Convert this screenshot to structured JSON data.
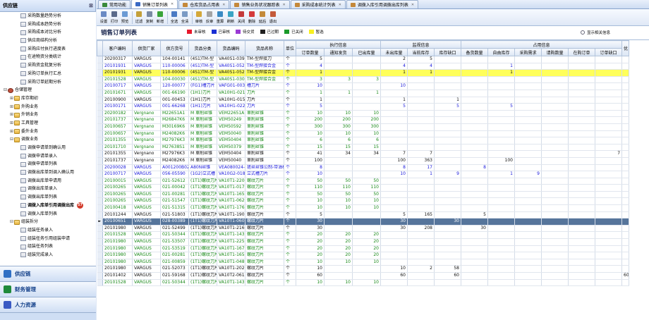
{
  "sidebar": {
    "title": "供应链",
    "tree": [
      {
        "label": "采购数量趋势分析",
        "level": 2,
        "type": "doc"
      },
      {
        "label": "采购成本趋势分析",
        "level": 2,
        "type": "doc"
      },
      {
        "label": "采购成本对比分析",
        "level": 2,
        "type": "doc"
      },
      {
        "label": "供应商结构分析",
        "level": 2,
        "type": "doc"
      },
      {
        "label": "采购应付执行进度表",
        "level": 2,
        "type": "doc"
      },
      {
        "label": "在途物资分类统计",
        "level": 2,
        "type": "doc"
      },
      {
        "label": "采购资金批复分析",
        "level": 2,
        "type": "doc"
      },
      {
        "label": "采购订单执行汇总",
        "level": 2,
        "type": "doc"
      },
      {
        "label": "采购订单延期分析",
        "level": 2,
        "type": "doc"
      },
      {
        "label": "仓储管理",
        "level": 0,
        "type": "gear",
        "exp": "⊟"
      },
      {
        "label": "库存期初",
        "level": 1,
        "type": "fold",
        "exp": "⊞"
      },
      {
        "label": "外购业务",
        "level": 1,
        "type": "fold",
        "exp": "⊞"
      },
      {
        "label": "外销业务",
        "level": 1,
        "type": "fold",
        "exp": "⊞"
      },
      {
        "label": "工具管理",
        "level": 1,
        "type": "fold",
        "exp": "⊞"
      },
      {
        "label": "委外业务",
        "level": 1,
        "type": "fold",
        "exp": "⊞"
      },
      {
        "label": "调拨业务",
        "level": 1,
        "type": "fold",
        "exp": "⊟"
      },
      {
        "label": "调拨申请单到确认用",
        "level": 2,
        "type": "doc"
      },
      {
        "label": "调拨申请单录入",
        "level": 2,
        "type": "doc"
      },
      {
        "label": "调拨申请单列表",
        "level": 2,
        "type": "doc"
      },
      {
        "label": "调拨出库单到调入确认用",
        "level": 2,
        "type": "doc"
      },
      {
        "label": "调拨出库单申请用",
        "level": 2,
        "type": "doc"
      },
      {
        "label": "调拨出库单录入",
        "level": 2,
        "type": "doc"
      },
      {
        "label": "调拨出库单列表",
        "level": 2,
        "type": "doc"
      },
      {
        "label": "调拨入库单引用调拨出库",
        "level": 2,
        "type": "doc",
        "selected": true,
        "badge": "57"
      },
      {
        "label": "调拨入库单列表",
        "level": 2,
        "type": "doc"
      },
      {
        "label": "组装拆分",
        "level": 1,
        "type": "fold",
        "exp": "⊟"
      },
      {
        "label": "组装任务录入",
        "level": 2,
        "type": "doc"
      },
      {
        "label": "组装任务引用组装申请",
        "level": 2,
        "type": "doc"
      },
      {
        "label": "组装任务列表",
        "level": 2,
        "type": "doc"
      },
      {
        "label": "组装完成录入",
        "level": 2,
        "type": "doc"
      }
    ],
    "nav": [
      {
        "label": "供应链",
        "color": "#2f6fc4"
      },
      {
        "label": "财务管理",
        "color": "#1f8a3a"
      },
      {
        "label": "人力资源",
        "color": "#3a5ac4"
      }
    ]
  },
  "tabs": [
    {
      "label": "常用功能",
      "color": "#3a8a3a"
    },
    {
      "label": "销售订单列表",
      "color": "#3a6ac4",
      "active": true,
      "close": "x"
    },
    {
      "label": "仓库货品占用表",
      "color": "#c4883a",
      "close": "x"
    },
    {
      "label": "销售业务状况跟踪表",
      "color": "#c4883a",
      "close": "x"
    },
    {
      "label": "采购成本统计列表",
      "color": "#c4883a",
      "close": "x"
    },
    {
      "label": "调拨入库引用调拨出库列表",
      "color": "#c4883a",
      "close": "x"
    }
  ],
  "toolbar": [
    {
      "label": "设置",
      "color": "#6a8ac4"
    },
    {
      "label": "打印",
      "color": "#5a6a8a"
    },
    {
      "label": "预览",
      "color": "#6a9ad4"
    },
    {
      "sep": true
    },
    {
      "label": "过滤",
      "color": "#c4a03a"
    },
    {
      "label": "复制",
      "color": "#7a8aa4"
    },
    {
      "label": "新增",
      "color": "#3aa43a"
    },
    {
      "sep": true
    },
    {
      "label": "全选",
      "color": "#4a7ac4"
    },
    {
      "label": "全清",
      "color": "#7a9ac4"
    },
    {
      "sep": true
    },
    {
      "label": "审核",
      "color": "#d4a83a"
    },
    {
      "label": "反审",
      "color": "#a4a4a4"
    },
    {
      "label": "重算",
      "color": "#3a8ac4"
    },
    {
      "label": "刷新",
      "color": "#3aa4c4"
    },
    {
      "label": "关闭",
      "color": "#c43a3a"
    },
    {
      "label": "删除",
      "color": "#d43a3a"
    },
    {
      "label": "延后",
      "color": "#c48a3a"
    },
    {
      "label": "退出",
      "color": "#c45a3a"
    }
  ],
  "page": {
    "title": "销售订单列表",
    "show_all": "显示相关信息"
  },
  "legend": [
    {
      "label": "未审核",
      "color": "#e8192c"
    },
    {
      "label": "已审核",
      "color": "#1a2fd4"
    },
    {
      "label": "待交货",
      "color": "#9a3ad4"
    },
    {
      "label": "已过期",
      "color": "#202020"
    },
    {
      "label": "已关闭",
      "color": "#1a9a2a"
    },
    {
      "label": "暂选",
      "color": "#f8f020"
    }
  ],
  "grid": {
    "group_headers": {
      "exec": "执行信息",
      "monitor": "监视信息",
      "occupy": "占用信息"
    },
    "columns": [
      "客户编码",
      "供货厂家",
      "供方货号",
      "货品分类",
      "货品编码",
      "货品名称",
      "单位",
      "订单数量",
      "通知发货",
      "已出库量",
      "未出库量",
      "当前库存",
      "库存缺口",
      "备货数量",
      "自由库存",
      "采购需求",
      "请购数量",
      "在购订单",
      "订单缺口",
      "优"
    ],
    "rows": [
      {
        "c": "c-black",
        "v": [
          "20200317",
          "VARGUS",
          "104-00141",
          "(4S1)TM-型",
          "VA40S1-0392",
          "TM-型焊接刀",
          "个",
          "5",
          "",
          "",
          "2",
          "5",
          "",
          "",
          "",
          "",
          "",
          "",
          "",
          ""
        ]
      },
      {
        "c": "c-blue",
        "v": [
          "20101931",
          "VARGUS",
          "110-00006",
          "(4S1)TM-型",
          "VA40S1-0521",
          "TM-型焊接合金",
          "个",
          "4",
          "",
          "",
          "4",
          "4",
          "",
          "",
          "1",
          "",
          "",
          "",
          "",
          ""
        ]
      },
      {
        "c": "c-yellow",
        "v": [
          "20101931",
          "VARGUS",
          "110-00006",
          "(4S1)TM-型",
          "VA40S1-0521",
          "TM-型焊接合金",
          "个",
          "1",
          "",
          "",
          "1",
          "1",
          "",
          "",
          "1",
          "",
          "",
          "",
          "",
          ""
        ]
      },
      {
        "c": "c-green",
        "v": [
          "20101528",
          "VARGUS",
          "104-00030",
          "(4S1)TM-型",
          "VA40S1-0309",
          "TM-型焊接合金",
          "个",
          "3",
          "3",
          "3",
          "",
          "",
          "",
          "",
          "",
          "",
          "",
          "",
          "",
          ""
        ]
      },
      {
        "c": "c-blue",
        "v": [
          "20100717",
          "VARGUS",
          "120-00077",
          "(FG1)槽刀片",
          "VAFG01-0034",
          "槽刀片",
          "个",
          "10",
          "",
          "",
          "10",
          "",
          "",
          "",
          "",
          "",
          "",
          "",
          "",
          ""
        ]
      },
      {
        "c": "c-green",
        "v": [
          "20101671",
          "VARGUS",
          "001-66190",
          "(1H1)刀片",
          "VA10H1-0212",
          "刀片",
          "个",
          "1",
          "1",
          "1",
          "",
          "",
          "",
          "",
          "",
          "",
          "",
          "",
          "",
          ""
        ]
      },
      {
        "c": "c-black",
        "v": [
          "20100900",
          "VARGUS",
          "001-00453",
          "(1H1)刀片",
          "VA10H1-0157",
          "刀片",
          "个",
          "1",
          "",
          "",
          "1",
          "",
          "1",
          "",
          "",
          "",
          "",
          "",
          "",
          ""
        ]
      },
      {
        "c": "c-blue",
        "v": [
          "20100171",
          "VARGUS",
          "001-66268",
          "(1H1)刀片",
          "VA10H1-0221",
          "刀片",
          "个",
          "5",
          "",
          "",
          "5",
          "",
          "5",
          "",
          "5",
          "",
          "",
          "",
          "",
          ""
        ]
      },
      {
        "c": "c-green",
        "v": [
          "20200182",
          "Vergnano",
          "M22651A1",
          "M 車削丝锥",
          "VEM22651A1",
          "車削丝锥",
          "个",
          "10",
          "10",
          "10",
          "",
          "",
          "",
          "",
          "",
          "",
          "",
          "",
          "",
          ""
        ]
      },
      {
        "c": "c-green",
        "v": [
          "20101737",
          "Vergnano",
          "M26847K6",
          "M 車削丝锥",
          "VEM50249",
          "車削丝锥",
          "个",
          "200",
          "200",
          "200",
          "",
          "",
          "",
          "",
          "",
          "",
          "",
          "",
          "",
          ""
        ]
      },
      {
        "c": "c-green",
        "v": [
          "20100657",
          "Vergnano",
          "M30169K6",
          "M 車削丝锥",
          "VEM50592",
          "車削丝锥",
          "个",
          "300",
          "300",
          "300",
          "",
          "",
          "",
          "",
          "",
          "",
          "",
          "",
          "",
          ""
        ]
      },
      {
        "c": "c-green",
        "v": [
          "20100657",
          "Vergnano",
          "M24082K6",
          "M 車削丝锥",
          "VEM50040",
          "車削丝锥",
          "个",
          "10",
          "10",
          "10",
          "",
          "",
          "",
          "",
          "",
          "",
          "",
          "",
          "",
          ""
        ]
      },
      {
        "c": "c-green",
        "v": [
          "20101355",
          "Vergnano",
          "M27976K3",
          "M 車削丝锥",
          "VEM50404",
          "車削丝锥",
          "个",
          "6",
          "6",
          "6",
          "",
          "",
          "",
          "",
          "",
          "",
          "",
          "",
          "",
          ""
        ]
      },
      {
        "c": "c-green",
        "v": [
          "20101710",
          "Vergnano",
          "M27638S1",
          "M 車削丝锥",
          "VEM50379",
          "車削丝锥",
          "个",
          "15",
          "15",
          "15",
          "",
          "",
          "",
          "",
          "",
          "",
          "",
          "",
          "",
          ""
        ]
      },
      {
        "c": "c-black",
        "v": [
          "20101355",
          "Vergnano",
          "M27976K3",
          "M 車削丝锥",
          "VEM50404",
          "車削丝锥",
          "个",
          "41",
          "34",
          "34",
          "7",
          "7",
          "",
          "",
          "",
          "",
          "",
          "",
          "7",
          ""
        ]
      },
      {
        "c": "c-black",
        "v": [
          "20101737",
          "Vergnano",
          "M24082K6",
          "M 車削丝锥",
          "VEM50040",
          "車削丝锥",
          "个",
          "100",
          "",
          "",
          "100",
          "363",
          "",
          "",
          "100",
          "",
          "",
          "",
          "",
          ""
        ]
      },
      {
        "c": "c-blue",
        "v": [
          "20200028",
          "VARGUS",
          "A001200B02G1A0",
          "A80N丝锥",
          "VEA080024-0026",
          "搓丝丝锥公制-带油槽",
          "个",
          "8",
          "",
          "",
          "8",
          "17",
          "",
          "8",
          "",
          "",
          "",
          "",
          "",
          ""
        ]
      },
      {
        "c": "c-blue",
        "v": [
          "20100717",
          "VARGUS",
          "056-05590",
          "(1G2)立式槽",
          "VA10G2-0184",
          "立式槽刀片",
          "个",
          "10",
          "",
          "",
          "10",
          "1",
          "9",
          "",
          "1",
          "9",
          "",
          "",
          "",
          ""
        ]
      },
      {
        "c": "c-green",
        "v": [
          "20100015",
          "VARGUS",
          "021-52612",
          "(1T1)螺纹刀片",
          "VA10T1-2200",
          "螺纹刀片",
          "个",
          "50",
          "50",
          "50",
          "",
          "",
          "",
          "",
          "",
          "",
          "",
          "",
          "",
          ""
        ]
      },
      {
        "c": "c-green",
        "v": [
          "20100265",
          "VARGUS",
          "021-00042",
          "(1T1)螺纹刀片",
          "VA10T1-0172",
          "螺纹刀片",
          "个",
          "110",
          "110",
          "110",
          "",
          "",
          "",
          "",
          "",
          "",
          "",
          "",
          "",
          ""
        ]
      },
      {
        "c": "c-green",
        "v": [
          "20100265",
          "VARGUS",
          "021-00281",
          "(1T1)螺纹刀片",
          "VA10T1-1658",
          "螺纹刀片",
          "个",
          "50",
          "50",
          "50",
          "",
          "",
          "",
          "",
          "",
          "",
          "",
          "",
          "",
          ""
        ]
      },
      {
        "c": "c-green",
        "v": [
          "20100265",
          "VARGUS",
          "021-51547",
          "(1T1)螺纹刀片",
          "VA10T1-0620",
          "螺纹刀片",
          "个",
          "10",
          "10",
          "10",
          "",
          "",
          "",
          "",
          "",
          "",
          "",
          "",
          "",
          ""
        ]
      },
      {
        "c": "c-green",
        "v": [
          "20100418",
          "VARGUS",
          "021-51315",
          "(1T1)螺纹刀片",
          "VA10T1-1763",
          "螺纹刀片",
          "个",
          "10",
          "10",
          "10",
          "",
          "",
          "",
          "",
          "",
          "",
          "",
          "",
          "",
          ""
        ]
      },
      {
        "c": "c-black",
        "v": [
          "20101244",
          "VARGUS",
          "021-51803",
          "(1T1)螺纹刀片",
          "VA10T1-1903",
          "螺纹刀片",
          "个",
          "5",
          "",
          "",
          "5",
          "165",
          "",
          "5",
          "",
          "",
          "",
          "",
          "",
          ""
        ]
      },
      {
        "c": "c-sel",
        "ind": "►",
        "v": [
          "20100651",
          "VARGUS",
          "028-00389",
          "(1T1)螺纹刀片",
          "VA10T1-0608",
          "螺纹刀片",
          "个",
          "30",
          "",
          "",
          "30",
          "",
          "30",
          "",
          "",
          "",
          "",
          "",
          "",
          ""
        ]
      },
      {
        "c": "c-black",
        "v": [
          "20101980",
          "VARGUS",
          "021-52499",
          "(1T1)螺纹刀片",
          "VA10T1-2169",
          "螺纹刀片",
          "个",
          "30",
          "",
          "",
          "30",
          "208",
          "",
          "30",
          "",
          "",
          "",
          "",
          "",
          ""
        ]
      },
      {
        "c": "c-green",
        "v": [
          "20101528",
          "VARGUS",
          "021-50344",
          "(1T1)螺纹刀片",
          "VA10T1-1433",
          "螺纹刀片",
          "个",
          "20",
          "20",
          "20",
          "",
          "",
          "",
          "",
          "",
          "",
          "",
          "",
          "",
          ""
        ]
      },
      {
        "c": "c-green",
        "v": [
          "20101980",
          "VARGUS",
          "021-53507",
          "(1T1)螺纹刀片",
          "VA10T1-2253",
          "螺纹刀片",
          "个",
          "20",
          "20",
          "20",
          "",
          "",
          "",
          "",
          "",
          "",
          "",
          "",
          "",
          ""
        ]
      },
      {
        "c": "c-green",
        "v": [
          "20101980",
          "VARGUS",
          "021-53519",
          "(1T1)螺纹刀片",
          "VA10T1-1671",
          "螺纹刀片",
          "个",
          "20",
          "20",
          "20",
          "",
          "",
          "",
          "",
          "",
          "",
          "",
          "",
          "",
          ""
        ]
      },
      {
        "c": "c-green",
        "v": [
          "20101980",
          "VARGUS",
          "021-00281",
          "(1T1)螺纹刀片",
          "VA10T1-1658",
          "螺纹刀片",
          "个",
          "20",
          "20",
          "20",
          "",
          "",
          "",
          "",
          "",
          "",
          "",
          "",
          "",
          ""
        ]
      },
      {
        "c": "c-green",
        "v": [
          "20101980",
          "VARGUS",
          "021-00859",
          "(1T1)螺纹刀片",
          "VA10T1-0489",
          "螺纹刀片",
          "个",
          "10",
          "10",
          "10",
          "",
          "",
          "",
          "",
          "",
          "",
          "",
          "",
          "",
          ""
        ]
      },
      {
        "c": "c-black",
        "v": [
          "20101980",
          "VARGUS",
          "021-52073",
          "(1T1)螺纹刀片",
          "VA10T1-2026",
          "螺纹刀片",
          "个",
          "10",
          "",
          "",
          "10",
          "2",
          "58",
          "",
          "",
          "",
          "",
          "",
          "",
          ""
        ]
      },
      {
        "c": "c-black",
        "v": [
          "20101402",
          "VARGUS",
          "021-59168",
          "(1T1)螺纹刀片",
          "VA10T2-0613",
          "螺纹刀片",
          "个",
          "60",
          "",
          "",
          "60",
          "",
          "60",
          "",
          "",
          "",
          "",
          "",
          "",
          "60"
        ]
      },
      {
        "c": "c-green",
        "v": [
          "20101528",
          "VARGUS",
          "021-50344",
          "(1T1)螺纹刀片",
          "VA10T1-1433",
          "螺纹刀片",
          "个",
          "10",
          "10",
          "10",
          "",
          "",
          "",
          "",
          "",
          "",
          "",
          "",
          "",
          ""
        ]
      }
    ]
  }
}
